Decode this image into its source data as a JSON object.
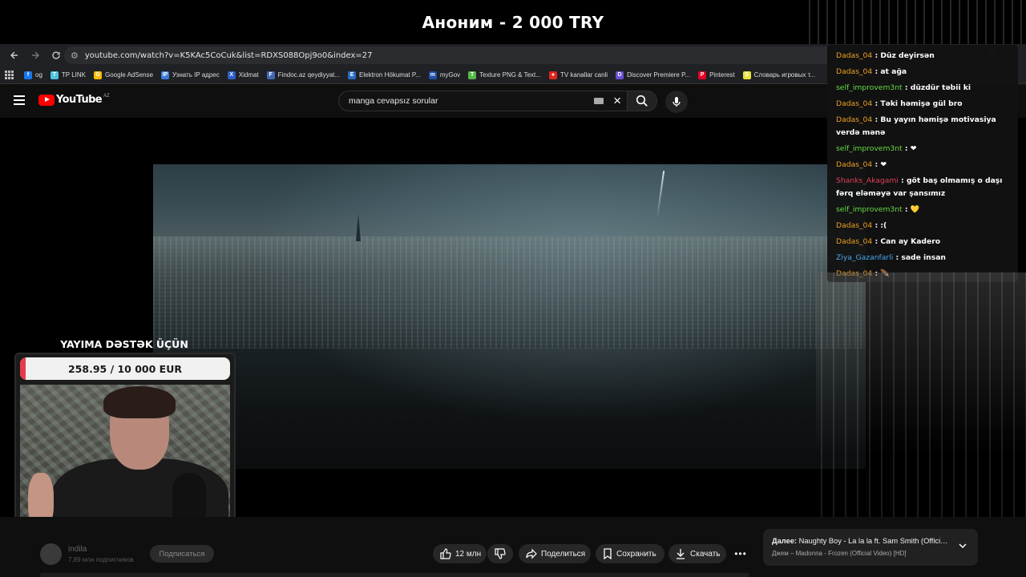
{
  "donation_banner": {
    "text": "Аноним - 2 000 TRY"
  },
  "browser": {
    "url": "youtube.com/watch?v=K5KAc5CoCuk&list=RDXS088Opj9o0&index=27",
    "bookmarks": [
      {
        "label": "og",
        "color": "#1877f2",
        "glyph": "f"
      },
      {
        "label": "TP LINK",
        "color": "#4ec3e0",
        "glyph": "T"
      },
      {
        "label": "Google AdSense",
        "color": "#fbbc04",
        "glyph": "G"
      },
      {
        "label": "Узнать IP адрес",
        "color": "#3a7bd5",
        "glyph": "IP"
      },
      {
        "label": "Xidmat",
        "color": "#2b5dcc",
        "glyph": "X"
      },
      {
        "label": "Findoc.az qeydiyyat...",
        "color": "#4267b2",
        "glyph": "F"
      },
      {
        "label": "Elektron Hökumat P...",
        "color": "#2a6cc4",
        "glyph": "E"
      },
      {
        "label": "myGov",
        "color": "#1e4fa8",
        "glyph": "m"
      },
      {
        "label": "Texture PNG & Text...",
        "color": "#56b949",
        "glyph": "T"
      },
      {
        "label": "TV kanallar canli",
        "color": "#e1251b",
        "glyph": "●"
      },
      {
        "label": "Discover Premiere P...",
        "color": "#6a4fd6",
        "glyph": "D"
      },
      {
        "label": "Pinterest",
        "color": "#e60023",
        "glyph": "P"
      },
      {
        "label": "Словарь игровых т...",
        "color": "#e8e23c",
        "glyph": "S"
      }
    ]
  },
  "youtube": {
    "logo_text": "YouTube",
    "logo_region": "AZ",
    "search_query": "manga cevapsız sorular"
  },
  "chat": {
    "messages": [
      {
        "user": "Dadas_04",
        "user_color": "#f0a020",
        "text": "Düz deyirsən"
      },
      {
        "user": "Dadas_04",
        "user_color": "#f0a020",
        "text": "at ağa"
      },
      {
        "user": "self_improvem3nt",
        "user_color": "#66dd44",
        "text": "düzdür təbii ki"
      },
      {
        "user": "Dadas_04",
        "user_color": "#f0a020",
        "text": "Təki həmişə gül bro"
      },
      {
        "user": "Dadas_04",
        "user_color": "#f0a020",
        "text": "Bu yayın həmişə motivasiya verdə mənə"
      },
      {
        "user": "self_improvem3nt",
        "user_color": "#66dd44",
        "text": "❤"
      },
      {
        "user": "Dadas_04",
        "user_color": "#f0a020",
        "text": "❤"
      },
      {
        "user": "Shanks_Akagami",
        "user_color": "#e0405a",
        "text": "göt baş olmamış o daşı fərq eləməyə var şansımız"
      },
      {
        "user": "self_improvem3nt",
        "user_color": "#66dd44",
        "text": "💛"
      },
      {
        "user": "Dadas_04",
        "user_color": "#f0a020",
        "text": ":("
      },
      {
        "user": "Dadas_04",
        "user_color": "#f0a020",
        "text": "Can ay Kadero"
      },
      {
        "user": "Ziya_Gazanfarli",
        "user_color": "#4aa8f0",
        "text": "sade insan"
      },
      {
        "user": "Dadas_04",
        "user_color": "#f0a020",
        "text": "🪶"
      }
    ]
  },
  "donation_widget": {
    "title": "YAYIMA DƏSTƏK ÜÇÜN",
    "goal_text": "258.95 / 10 000 EUR",
    "progress_fraction": 0.026
  },
  "video_meta": {
    "channel_name": "indila",
    "subscribers": "7,89 млн подписчиков",
    "subscribe_label": "Подписаться",
    "likes": "12 млн",
    "share_label": "Поделиться",
    "save_label": "Сохранить",
    "download_label": "Скачать"
  },
  "next_up": {
    "title_prefix": "Далее:",
    "title": "Naughty Boy - La la la ft. Sam Smith (Officia...",
    "subtitle": "Джем – Madonna - Frozen (Official Video) [HD]"
  }
}
